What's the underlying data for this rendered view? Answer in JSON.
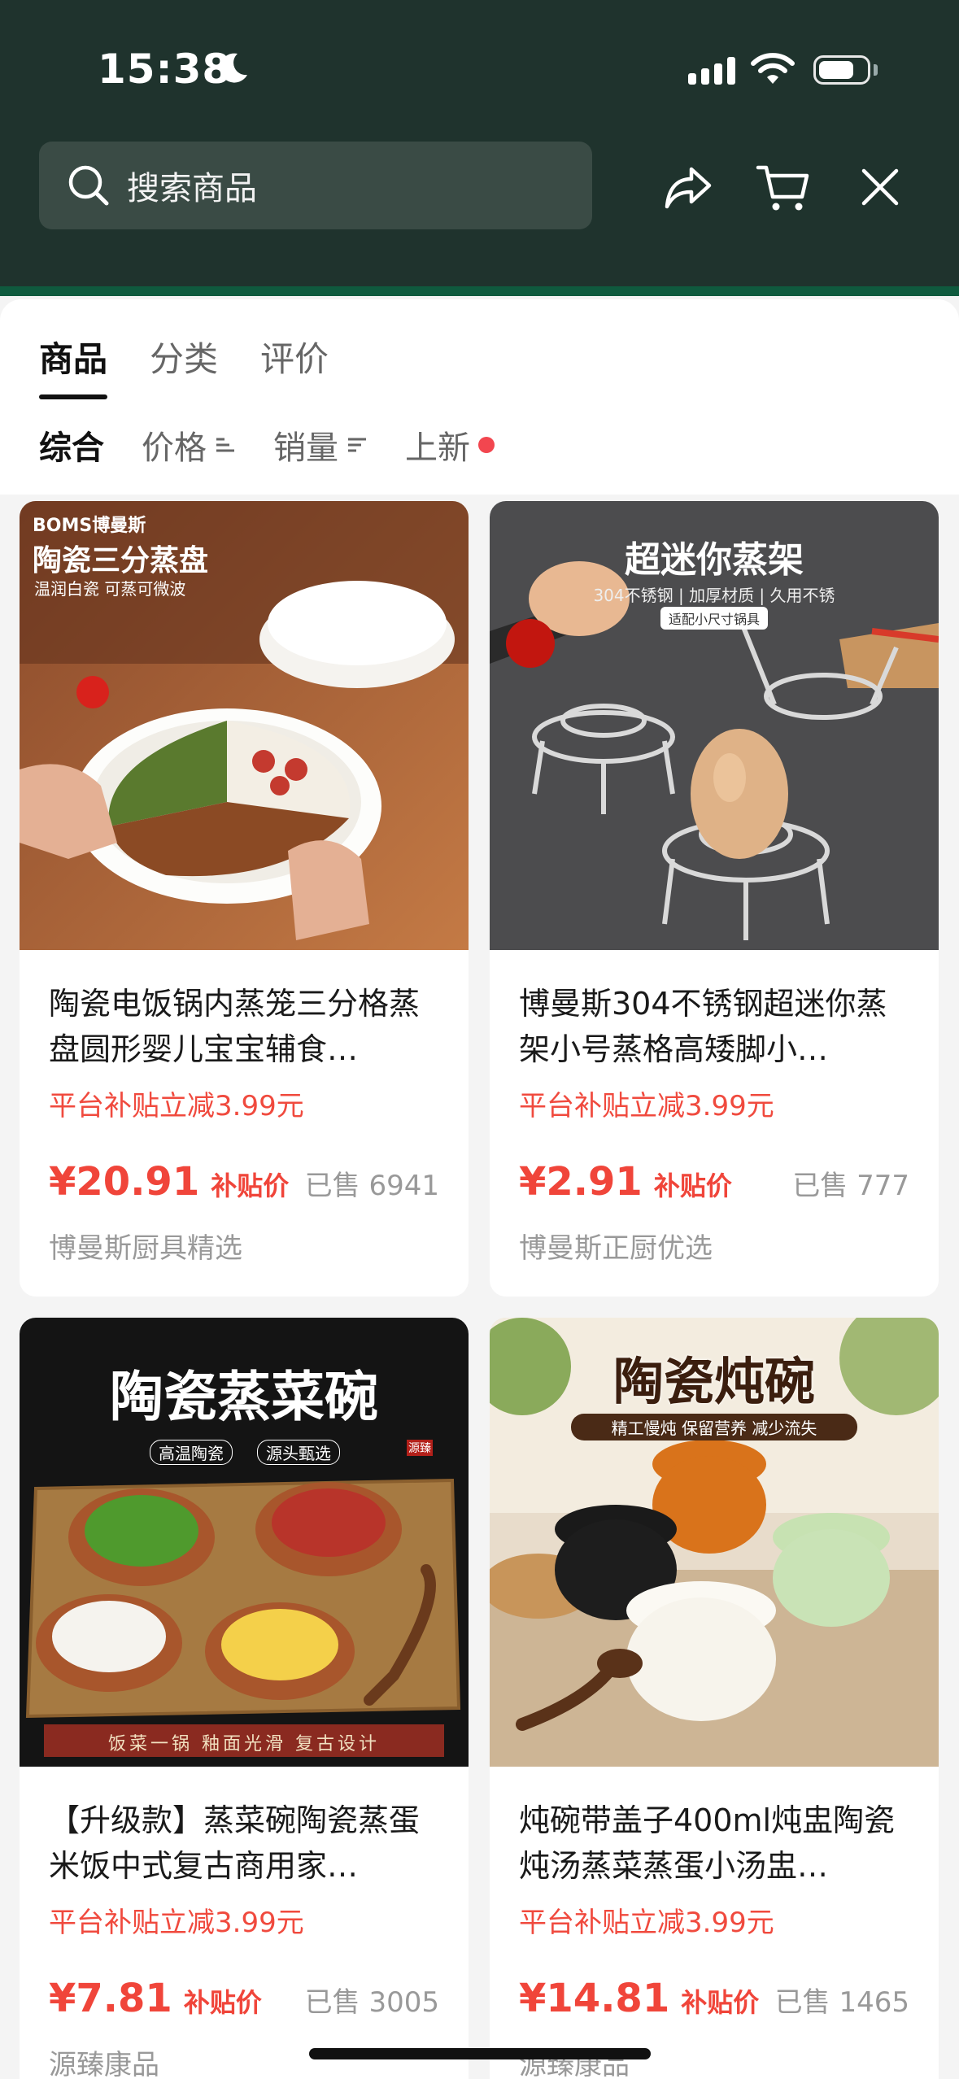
{
  "status_bar": {
    "time": "15:38"
  },
  "search": {
    "placeholder": "搜索商品"
  },
  "tabs": [
    {
      "label": "商品",
      "active": true
    },
    {
      "label": "分类",
      "active": false
    },
    {
      "label": "评价",
      "active": false
    }
  ],
  "sorts": [
    {
      "label": "综合",
      "active": true
    },
    {
      "label": "价格",
      "icon": "sort-icon"
    },
    {
      "label": "销量",
      "icon": "sort-icon"
    },
    {
      "label": "上新",
      "icon": "new-dot"
    }
  ],
  "products": [
    {
      "title": "陶瓷电饭锅内蒸笼三分格蒸盘圆形婴儿宝宝辅食…",
      "promo": "平台补贴立减3.99元",
      "price": "¥20.91",
      "price_tag": "补贴价",
      "sold": "已售 6941",
      "shop": "博曼斯厨具精选",
      "image": {
        "brand": "BOMS博曼斯",
        "headline": "陶瓷三分蒸盘",
        "sub": "温润白瓷 可蒸可微波"
      }
    },
    {
      "title": "博曼斯304不锈钢超迷你蒸架小号蒸格高矮脚小…",
      "promo": "平台补贴立减3.99元",
      "price": "¥2.91",
      "price_tag": "补贴价",
      "sold": "已售 777",
      "shop": "博曼斯正厨优选",
      "image": {
        "headline": "超迷你蒸架",
        "sub": "304不锈钢 | 加厚材质 | 久用不锈",
        "badge": "适配小尺寸锅具"
      }
    },
    {
      "title": "【升级款】蒸菜碗陶瓷蒸蛋米饭中式复古商用家…",
      "promo": "平台补贴立减3.99元",
      "price": "¥7.81",
      "price_tag": "补贴价",
      "sold": "已售 3005",
      "shop": "源臻康品",
      "image": {
        "headline": "陶瓷蒸菜碗",
        "sub_left": "高温陶瓷",
        "sub_right": "源头甄选",
        "seal": "源臻",
        "footer": "饭菜一锅 釉面光滑 复古设计"
      }
    },
    {
      "title": "炖碗带盖子400ml炖盅陶瓷炖汤蒸菜蒸蛋小汤盅…",
      "promo": "平台补贴立减3.99元",
      "price": "¥14.81",
      "price_tag": "补贴价",
      "sold": "已售 1465",
      "shop": "源臻康品",
      "image": {
        "headline": "陶瓷炖碗",
        "sub": "精工慢炖 保留营养 减少流失"
      }
    }
  ]
}
